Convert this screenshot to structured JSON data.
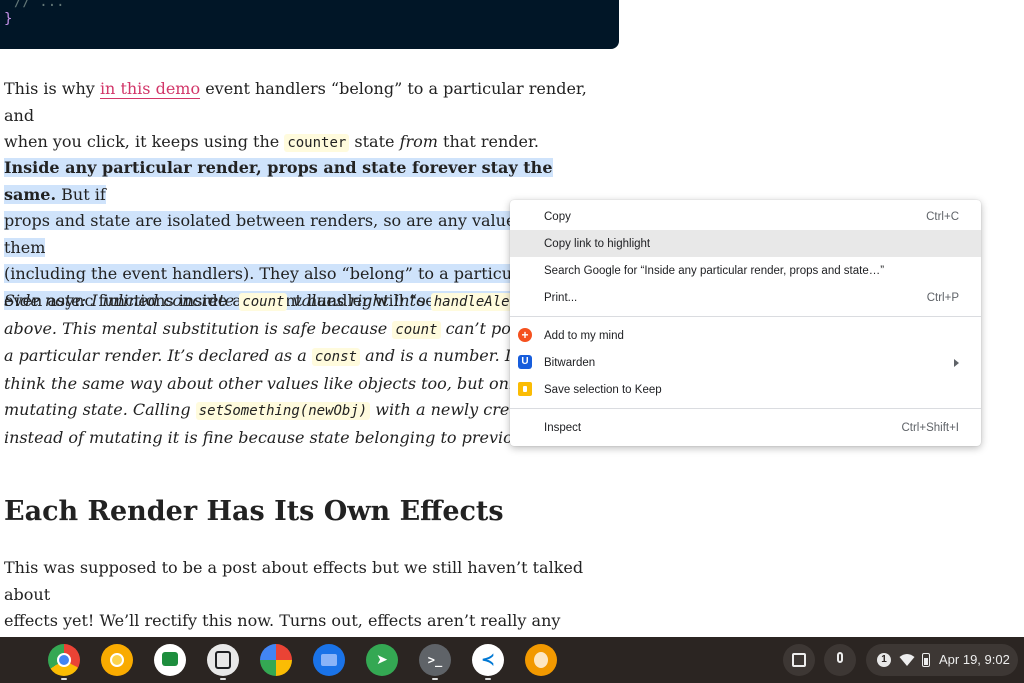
{
  "code": {
    "comment_line": "// ...",
    "closing_brace": "}"
  },
  "paragraph1": {
    "pre": "This is why ",
    "link": "in this demo",
    "mid": " event handlers “belong” to a particular render, and",
    "line2_pre": "when you click, it keeps using the ",
    "code": "counter",
    "line2_mid": " state ",
    "em": "from",
    "line2_post": " that render."
  },
  "paragraph2": {
    "strong": "Inside any particular render, props and state forever stay the same.",
    "l1_post": " But if",
    "l2": "props and state are isolated between renders, so are any values using them",
    "l3": "(including the event handlers). They also “belong” to a particular re",
    "l4": "even async functions inside an event handler will “see” the same ",
    "l4_code": "co"
  },
  "paragraph3": {
    "l1_pre": "Side note: I inlined concrete ",
    "l1_code1": "count",
    "l1_mid": " values right into ",
    "l1_code2": "handleAlertClic",
    "l2_pre": "above. This mental substitution is safe because ",
    "l2_code": "count",
    "l2_post": " can’t possibly cha",
    "l3_pre": "a particular render. It’s declared as a ",
    "l3_code": "const",
    "l3_post": " and is a number. It would b",
    "l4": "think the same way about other values like objects too, but only if we agr",
    "l5_pre": "mutating state. Calling ",
    "l5_code": "setSomething(newObj)",
    "l5_post": " with a newly created",
    "l6": "instead of mutating it is fine because state belonging to previous renders"
  },
  "section_title": "Each Render Has Its Own Effects",
  "paragraph4": {
    "l1": "This was supposed to be a post about effects but we still haven’t talked about",
    "l2": "effects yet! We’ll rectify this now. Turns out, effects aren’t really any different."
  },
  "context_menu": {
    "items": [
      {
        "label": "Copy",
        "shortcut": "Ctrl+C"
      },
      {
        "label": "Copy link to highlight",
        "shortcut": ""
      },
      {
        "label": "Search Google for “Inside any particular render, props and state…”",
        "shortcut": ""
      },
      {
        "label": "Print...",
        "shortcut": "Ctrl+P"
      },
      {
        "label": "Add to my mind",
        "icon": "mymind-icon"
      },
      {
        "label": "Bitwarden",
        "icon": "bitwarden-icon",
        "submenu": true
      },
      {
        "label": "Save selection to Keep",
        "icon": "keep-icon"
      },
      {
        "label": "Inspect",
        "shortcut": "Ctrl+Shift+I"
      }
    ]
  },
  "shelf": {
    "apps": [
      {
        "name": "chrome-icon",
        "color": "#4285f4"
      },
      {
        "name": "chrome-canary-icon",
        "color": "#f9ab00"
      },
      {
        "name": "google-chat-icon",
        "color": "#1e8e3e"
      },
      {
        "name": "screen-capture-icon",
        "color": "#e8e8e8"
      },
      {
        "name": "google-photos-icon",
        "color": "#ea4335"
      },
      {
        "name": "files-icon",
        "color": "#1a73e8"
      },
      {
        "name": "telegram-icon",
        "color": "#34a853"
      },
      {
        "name": "terminal-icon",
        "color": "#5f6368"
      },
      {
        "name": "vscode-icon",
        "color": "#ffffff"
      },
      {
        "name": "app-icon",
        "color": "#f29900"
      }
    ],
    "notification_count": "1",
    "clock": "Apr 19, 9:02"
  }
}
